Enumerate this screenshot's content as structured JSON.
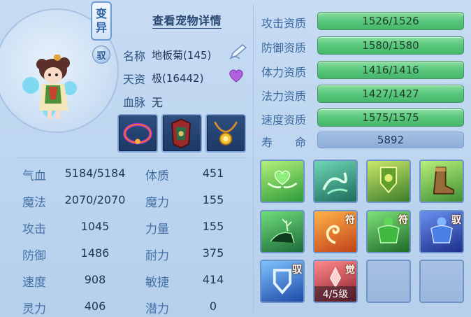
{
  "pet": {
    "mutation_badge": [
      "变",
      "异"
    ],
    "ride_badge": "驭",
    "details_link": "查看宠物详情",
    "name_label": "名称",
    "name_value": "地板菊(145)",
    "talent_label": "天资",
    "talent_value": "极(16442)",
    "bloodline_label": "血脉",
    "bloodline_value": "无"
  },
  "items": [
    {
      "name": "collar-item"
    },
    {
      "name": "armor-item"
    },
    {
      "name": "amulet-item"
    }
  ],
  "stats": [
    {
      "label": "气血",
      "value": "5184/5184",
      "label2": "体质",
      "value2": "451"
    },
    {
      "label": "魔法",
      "value": "2070/2070",
      "label2": "魔力",
      "value2": "155"
    },
    {
      "label": "攻击",
      "value": "1045",
      "label2": "力量",
      "value2": "155"
    },
    {
      "label": "防御",
      "value": "1486",
      "label2": "耐力",
      "value2": "375"
    },
    {
      "label": "速度",
      "value": "908",
      "label2": "敏捷",
      "value2": "414"
    },
    {
      "label": "灵力",
      "value": "406",
      "label2": "潜力",
      "value2": "0"
    }
  ],
  "aptitudes": [
    {
      "label": "攻击资质",
      "value": "1526/1526"
    },
    {
      "label": "防御资质",
      "value": "1580/1580"
    },
    {
      "label": "体力资质",
      "value": "1416/1416"
    },
    {
      "label": "法力资质",
      "value": "1427/1427"
    },
    {
      "label": "速度资质",
      "value": "1575/1575"
    }
  ],
  "life": {
    "label": "寿　　命",
    "value": "5892"
  },
  "skills": [
    {
      "icon": "heart-wings-icon",
      "tag": ""
    },
    {
      "icon": "green-wind-icon",
      "tag": ""
    },
    {
      "icon": "shield-emblem-icon",
      "tag": ""
    },
    {
      "icon": "boot-icon",
      "tag": ""
    },
    {
      "icon": "deer-icon",
      "tag": ""
    },
    {
      "icon": "fire-swirl-icon",
      "tag": "符"
    },
    {
      "icon": "green-muscle-icon",
      "tag": "符"
    },
    {
      "icon": "blue-muscle-icon",
      "tag": "驭"
    },
    {
      "icon": "blue-shield-icon",
      "tag": "驭"
    },
    {
      "icon": "red-awaken-icon",
      "tag": "觉",
      "level": "4/5级"
    },
    {
      "icon": "empty-slot",
      "tag": ""
    },
    {
      "icon": "empty-slot",
      "tag": ""
    }
  ]
}
